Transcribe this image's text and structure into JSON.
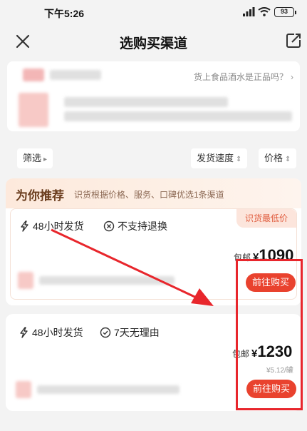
{
  "status_bar": {
    "time": "下午5:26",
    "battery": "93"
  },
  "header": {
    "title": "选购买渠道"
  },
  "product": {
    "authentic_text": "货上食品酒水是正品吗？",
    "authentic_arrow": "›"
  },
  "filters": [
    {
      "label": "筛选",
      "caret": "▸"
    },
    {
      "label": "发货速度",
      "caret": "⇕"
    },
    {
      "label": "价格",
      "caret": "⇕"
    }
  ],
  "recommend": {
    "heading": "为你推荐",
    "subtitle": "识货根据价格、服务、口碑优选1条渠道",
    "badge": "识货最低价",
    "shipping": "48小时发货",
    "return_policy": "不支持退换",
    "price_label": "包邮",
    "currency": "¥",
    "price": "1090",
    "buy_label": "前往购买"
  },
  "second": {
    "shipping": "48小时发货",
    "return_policy": "7天无理由",
    "price_label": "包邮",
    "currency": "¥",
    "price": "1230",
    "unit_price": "¥5.12/罐",
    "buy_label": "前往购买"
  },
  "colors": {
    "accent": "#e9422e",
    "annotation": "#e8262c",
    "band": "#fde9dc"
  },
  "icons": [
    "close-icon",
    "share-icon",
    "lightning-icon",
    "no-return-icon",
    "check-circle-icon",
    "signal-icon",
    "wifi-icon",
    "battery-icon"
  ]
}
